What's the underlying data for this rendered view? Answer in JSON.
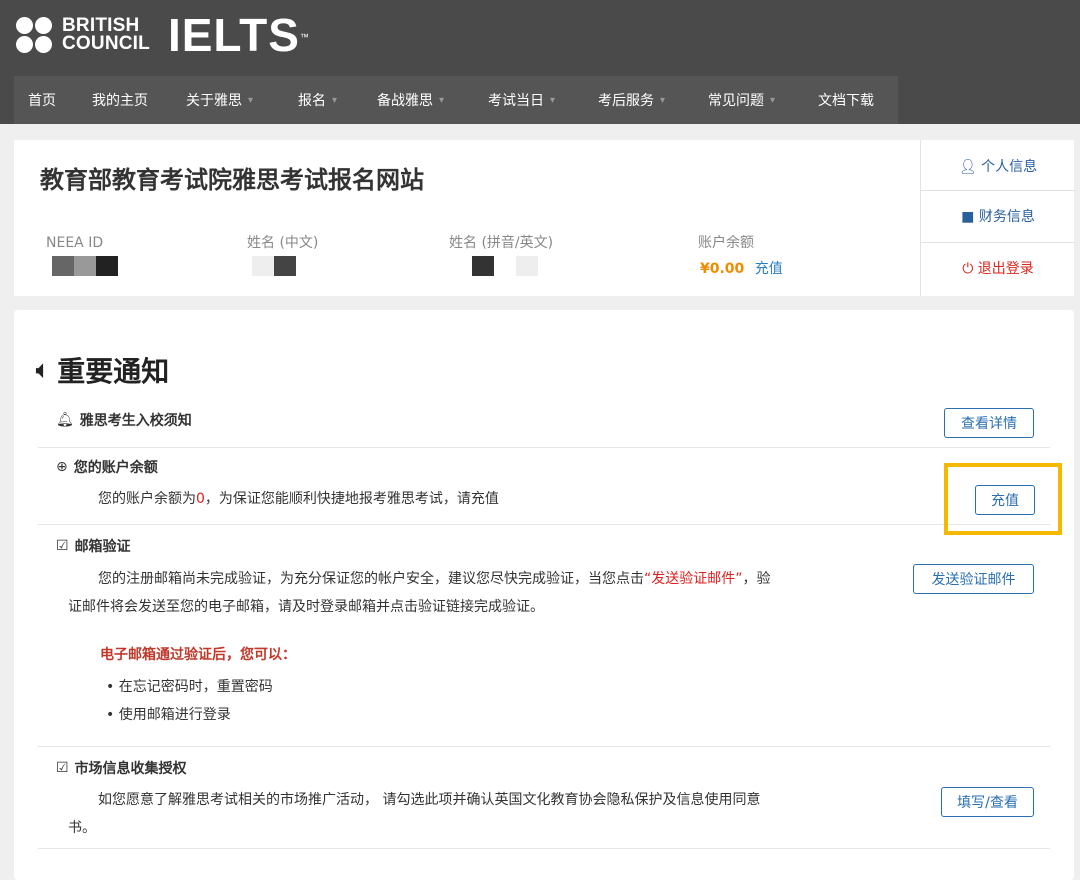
{
  "header": {
    "brand_line1": "BRITISH",
    "brand_line2": "COUNCIL",
    "product": "IELTS",
    "tm": "™"
  },
  "nav": [
    {
      "label": "首页",
      "dropdown": false
    },
    {
      "label": "我的主页",
      "dropdown": false
    },
    {
      "label": "关于雅思",
      "dropdown": true
    },
    {
      "label": "报名",
      "dropdown": true
    },
    {
      "label": "备战雅思",
      "dropdown": true
    },
    {
      "label": "考试当日",
      "dropdown": true
    },
    {
      "label": "考后服务",
      "dropdown": true
    },
    {
      "label": "常见问题",
      "dropdown": true
    },
    {
      "label": "文档下载",
      "dropdown": false
    }
  ],
  "profile": {
    "site_title": "教育部教育考试院雅思考试报名网站",
    "neea_label": "NEEA ID",
    "name_cn_label": "姓名 (中文)",
    "name_en_label": "姓名 (拼音/英文)",
    "balance_label": "账户余额",
    "balance_value": "¥0.00",
    "recharge_link": "充值",
    "side": {
      "personal_info": "个人信息",
      "finance_info": "财务信息",
      "logout": "退出登录"
    }
  },
  "notices": {
    "title": "重要通知",
    "items": [
      {
        "heading": "雅思考生入校须知",
        "button": "查看详情"
      },
      {
        "heading": "您的账户余额",
        "text_before": "您的账户余额为",
        "text_value": "0",
        "text_after": "，为保证您能顺利快捷地报考雅思考试，请充值",
        "button": "充值"
      },
      {
        "heading": "邮箱验证",
        "text_line1_before": "您的注册邮箱尚未完成验证，为充分保证您的帐户安全，建议您尽快完成验证，当您点击",
        "text_line1_highlight": "“发送验证邮件”",
        "text_line1_after": "，验",
        "text_line2": "证邮件将会发送至您的电子邮箱，请及时登录邮箱并点击验证链接完成验证。",
        "note": "电子邮箱通过验证后，您可以：",
        "bullets": [
          "在忘记密码时，重置密码",
          "使用邮箱进行登录"
        ],
        "button": "发送验证邮件"
      },
      {
        "heading": "市场信息收集授权",
        "text_line1": "如您愿意了解雅思考试相关的市场推广活动， 请勾选此项并确认英国文化教育协会隐私保护及信息使用同意",
        "text_line2": "书。",
        "button": "填写/查看"
      }
    ]
  },
  "colors": {
    "header_bg": "#4a4a4a",
    "nav_bg": "#555555",
    "link_blue": "#2a6fb0",
    "balance_orange": "#f08c00",
    "highlight_yellow": "#f5b800",
    "alert_red": "#e02020"
  }
}
